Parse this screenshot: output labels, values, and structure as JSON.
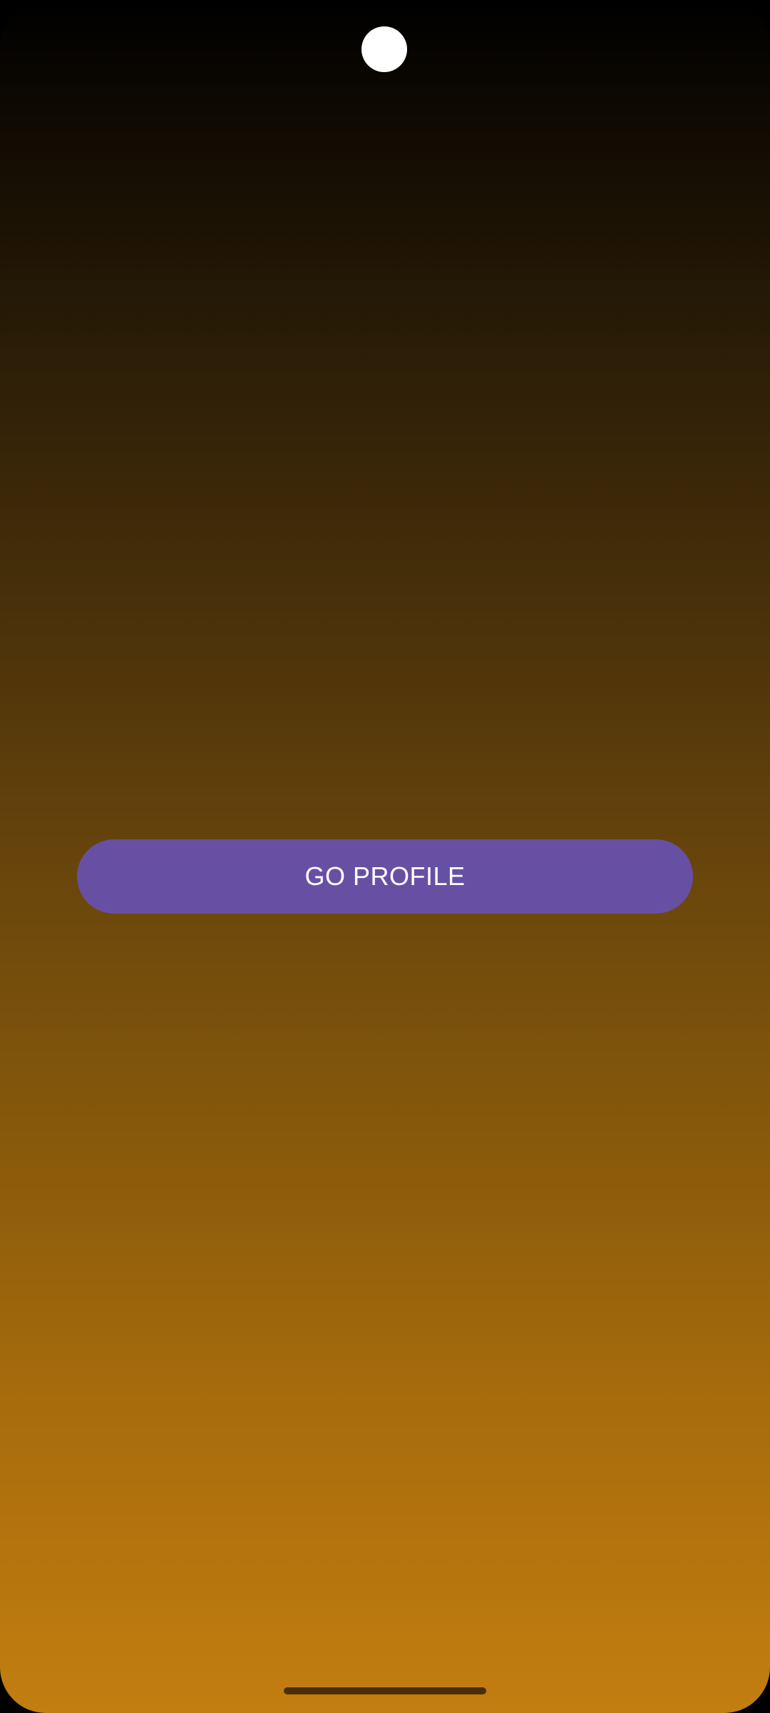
{
  "status_bar": {
    "camera_icon": "front-camera-cutout"
  },
  "main": {
    "profile_button_label": "GO PROFILE"
  },
  "navigation": {
    "gesture_handle": "home-gesture-handle"
  },
  "colors": {
    "button_background": "#6750a4",
    "button_text": "#ffffff",
    "gradient_top": "#000000",
    "gradient_bottom": "#c27e10"
  }
}
